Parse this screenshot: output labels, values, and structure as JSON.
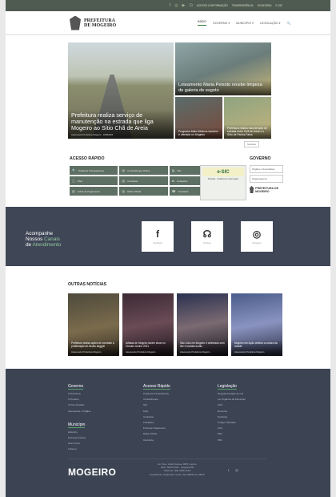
{
  "topbar": {
    "links": [
      "ACESSO À INFORMAÇÃO",
      "TRANSPARÊNCIA",
      "OUVIDORIA",
      "E-SIC"
    ],
    "icons": [
      "facebook-icon",
      "instagram-icon",
      "youtube-icon",
      "podcast-icon"
    ]
  },
  "header": {
    "logo_line1": "PREFEITURA",
    "logo_line2": "DE MOGEIRO",
    "nav": [
      "INÍCIO",
      "GOVERNO ▾",
      "MUNICÍPIO ▾",
      "LEGISLAÇÃO ▾",
      "🔍"
    ]
  },
  "hero": {
    "main": {
      "title": "Prefeitura realiza serviço de manutenção na estrada que liga Mogeiro ao Sítio Chã de Areia",
      "meta": "Assessoria Prefeitura Mogeiro · 18/8/2021"
    },
    "side_top": {
      "title": "Loteamento Maria Peixoto recebe limpeza de galeria de esgoto"
    },
    "side_b1": {
      "title": "Programa Mais Médicos também é ofertado no Mogeiro"
    },
    "side_b2": {
      "title": "Prefeitura realiza manutenção de estrada entre Chã de Areia e o Sítio de Fanha-Faixa"
    },
    "archive_label": "Notícias"
  },
  "quick_access": {
    "title": "ACESSO RÁPIDO",
    "items": [
      {
        "icon": "🔍",
        "label": "Portal da Transparência"
      },
      {
        "icon": "▤",
        "label": "Contracheque Online"
      },
      {
        "icon": "▤",
        "label": "SIC"
      },
      {
        "icon": "▢",
        "label": "FAQ"
      },
      {
        "icon": "▤",
        "label": "Contratos"
      },
      {
        "icon": "⇄",
        "label": "Licitações"
      },
      {
        "icon": "▤",
        "label": "Folha de Pagamento"
      },
      {
        "icon": "▤",
        "label": "Diário Oficial"
      },
      {
        "icon": "☎",
        "label": "Ouvidoria"
      }
    ]
  },
  "esic": {
    "badge": "e-SIC",
    "sub": "Dúvidas · Pedidos de informação"
  },
  "governo": {
    "title": "GOVERNO",
    "items": [
      "Órgãos e Secretarias",
      "Organograma"
    ],
    "brand": "PREFEITURA DE MOGEIRO"
  },
  "band": {
    "line1": "Acompanhe",
    "line2": "Nossos",
    "line2_highlight": "Canais",
    "line3": "de",
    "line3_highlight": "Atendimento",
    "tiles": [
      {
        "glyph": "f",
        "label": "Facebook"
      },
      {
        "glyph": "☊",
        "label": "Podcast"
      },
      {
        "glyph": "◎",
        "label": "Instagram"
      }
    ]
  },
  "other_news": {
    "title": "OUTRAS NOTÍCIAS",
    "items": [
      {
        "title": "Prefeitura realiza ações de combate à proliferação de Aedes aegypti",
        "meta": "Assessoria Prefeitura Mogeiro"
      },
      {
        "title": "Artistas de Mogeiro fazem show no Circuito Junino 2021",
        "meta": "Assessoria Prefeitura Mogeiro"
      },
      {
        "title": "São João em Mogeiro é celebrado com live e bandas locais",
        "meta": "Assessoria Prefeitura Mogeiro"
      },
      {
        "title": "Mogeiro em Ação celebra a cultura da cidade",
        "meta": "Assessoria Prefeitura Mogeiro"
      }
    ]
  },
  "footer": {
    "governo": {
      "title": "Governo",
      "items": [
        "A Prefeitura",
        "O Prefeito",
        "O Vice-Prefeito",
        "Secretarias e Órgãos"
      ]
    },
    "municipio": {
      "title": "Município",
      "items": [
        "Histórico",
        "Pessoas Ilustres",
        "Hino Cívico",
        "Turismo"
      ]
    },
    "acesso": {
      "title": "Acesso Rápido",
      "items": [
        "Portal da Transparência",
        "Contracheque",
        "SIC",
        "FAQ",
        "Contratos",
        "Licitações",
        "Folha de Pagamento",
        "Diário Oficial",
        "Ouvidoria"
      ]
    },
    "legislacao": {
      "title": "Legislação",
      "items": [
        "Regulamentação da LAI",
        "Lei Orgânica do Município",
        "LDO",
        "Decretos",
        "Portarias",
        "Código Tributário",
        "LOA",
        "PPA",
        "PPA"
      ]
    },
    "brand": "MOGEIRO",
    "address": [
      "Av. Pres. João Pessoa, 88 B, Centro",
      "CEP: 58375-000 – Mogeiro/PB",
      "Telefone: (83) 3286-1152",
      "Expediente: Segunda à sexta, das 08h00 às 14h00"
    ],
    "social": [
      "f",
      "◎"
    ]
  }
}
